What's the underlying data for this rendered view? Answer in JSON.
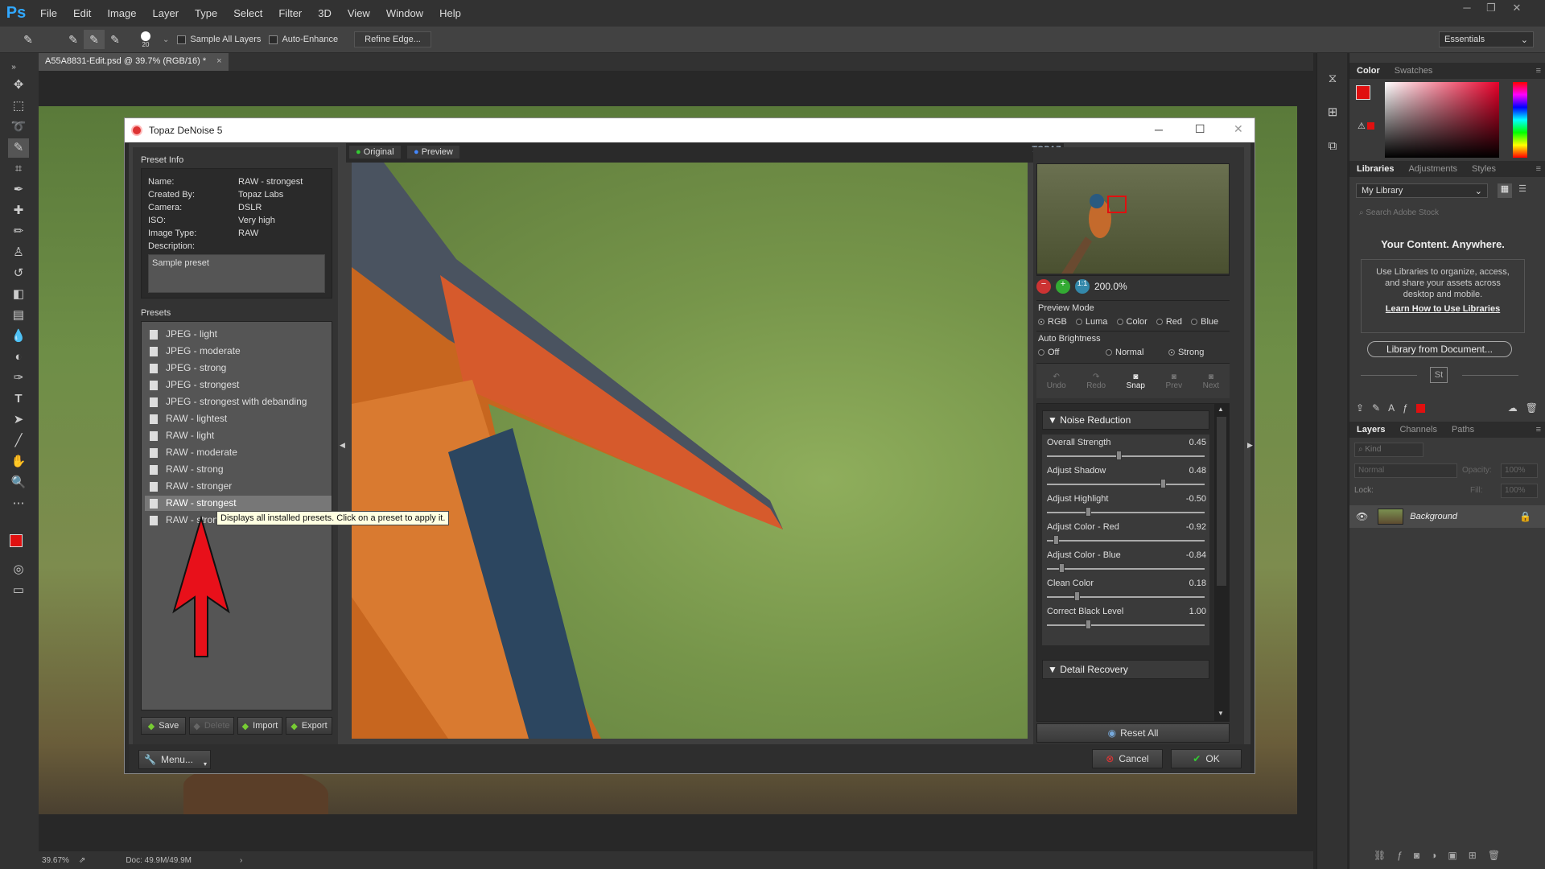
{
  "menubar": {
    "logo": "Ps",
    "items": [
      "File",
      "Edit",
      "Image",
      "Layer",
      "Type",
      "Select",
      "Filter",
      "3D",
      "View",
      "Window",
      "Help"
    ]
  },
  "options": {
    "brush_size": "20",
    "sample_all_layers": "Sample All Layers",
    "auto_enhance": "Auto-Enhance",
    "refine_edge": "Refine Edge...",
    "workspace": "Essentials"
  },
  "document": {
    "tab_label": "A55A8831-Edit.psd @ 39.7% (RGB/16) *",
    "zoom": "39.67%",
    "doc_size": "Doc: 49.9M/49.9M"
  },
  "right_panel": {
    "color_tabs": [
      "Color",
      "Swatches"
    ],
    "lib_tabs": [
      "Libraries",
      "Adjustments",
      "Styles"
    ],
    "library_select": "My Library",
    "search_placeholder": "Search Adobe Stock",
    "headline": "Your Content. Anywhere.",
    "body": "Use Libraries to organize, access, and share your assets across desktop and mobile.",
    "learn_link": "Learn How to Use Libraries",
    "from_doc_button": "Library from Document...",
    "stock_badge": "St",
    "layer_tabs": [
      "Layers",
      "Channels",
      "Paths"
    ],
    "kind_filter": "Kind",
    "blend_mode": "Normal",
    "opacity_label": "Opacity:",
    "opacity_value": "100%",
    "lock_label": "Lock:",
    "fill_label": "Fill:",
    "fill_value": "100%",
    "layer_name": "Background",
    "foreground_color": "#e01010",
    "background_color": "#000000"
  },
  "dialog": {
    "title": "Topaz DeNoise 5",
    "preset_info": {
      "header": "Preset Info",
      "fields": [
        {
          "label": "Name:",
          "value": "RAW - strongest"
        },
        {
          "label": "Created By:",
          "value": "Topaz Labs"
        },
        {
          "label": "Camera:",
          "value": "DSLR"
        },
        {
          "label": "ISO:",
          "value": "Very high"
        },
        {
          "label": "Image Type:",
          "value": "RAW"
        },
        {
          "label": "Description:",
          "value": ""
        }
      ],
      "description": "Sample preset"
    },
    "presets_header": "Presets",
    "presets": [
      "JPEG - light",
      "JPEG - moderate",
      "JPEG - strong",
      "JPEG - strongest",
      "JPEG - strongest with debanding",
      "RAW - lightest",
      "RAW - light",
      "RAW - moderate",
      "RAW - strong",
      "RAW - stronger",
      "RAW - strongest",
      "RAW - stronge"
    ],
    "selected_preset": "RAW - strongest",
    "tooltip": "Displays all installed presets. Click on a preset to apply it.",
    "preset_buttons": [
      "Save",
      "Delete",
      "Import",
      "Export"
    ],
    "view_tabs": [
      "Original",
      "Preview"
    ],
    "logo_text": "TOPAZ",
    "zoom": "200.0%",
    "preview_mode": {
      "label": "Preview Mode",
      "options": [
        "RGB",
        "Luma",
        "Color",
        "Red",
        "Blue"
      ],
      "selected": "RGB"
    },
    "auto_brightness": {
      "label": "Auto Brightness",
      "options": [
        "Off",
        "Normal",
        "Strong"
      ],
      "selected": "Strong"
    },
    "history_buttons": [
      "Undo",
      "Redo",
      "Snap",
      "Prev",
      "Next"
    ],
    "noise_reduction": {
      "header": "Noise Reduction",
      "sliders": [
        {
          "name": "Overall Strength",
          "value": "0.45",
          "pos": 0.45
        },
        {
          "name": "Adjust Shadow",
          "value": "0.48",
          "pos": 0.74
        },
        {
          "name": "Adjust Highlight",
          "value": "-0.50",
          "pos": 0.25
        },
        {
          "name": "Adjust Color - Red",
          "value": "-0.92",
          "pos": 0.04
        },
        {
          "name": "Adjust Color - Blue",
          "value": "-0.84",
          "pos": 0.08
        },
        {
          "name": "Clean Color",
          "value": "0.18",
          "pos": 0.18
        },
        {
          "name": "Correct Black Level",
          "value": "1.00",
          "pos": 0.25
        }
      ]
    },
    "detail_recovery": "Detail Recovery",
    "reset_all": "Reset All",
    "menu_button": "Menu...",
    "cancel_button": "Cancel",
    "ok_button": "OK"
  }
}
